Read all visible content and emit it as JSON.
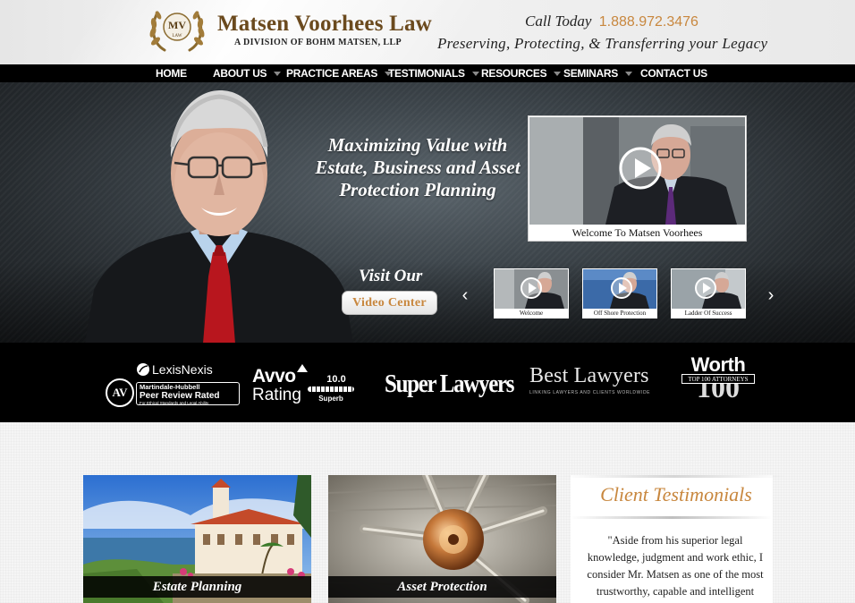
{
  "header": {
    "logo_initials": "MV",
    "logo_seal_word": "LAW",
    "firm_name": "Matsen Voorhees Law",
    "firm_sub": "A DIVISION OF BOHM MATSEN, LLP",
    "call_label": "Call Today",
    "phone": "1.888.972.3476",
    "tagline": "Preserving, Protecting, & Transferring your Legacy"
  },
  "nav": {
    "items": [
      {
        "label": "HOME",
        "has_menu": false
      },
      {
        "label": "ABOUT US",
        "has_menu": true
      },
      {
        "label": "PRACTICE AREAS",
        "has_menu": true
      },
      {
        "label": "TESTIMONIALS",
        "has_menu": true
      },
      {
        "label": "RESOURCES",
        "has_menu": true
      },
      {
        "label": "SEMINARS",
        "has_menu": true
      },
      {
        "label": "CONTACT US",
        "has_menu": false
      }
    ]
  },
  "hero": {
    "headline": "Maximizing Value with Estate, Business and Asset Protection Planning",
    "main_video_caption": "Welcome To Matsen Voorhees",
    "visit_label": "Visit Our",
    "video_center_button": "Video Center",
    "prev_icon": "chevron-left-icon",
    "next_icon": "chevron-right-icon",
    "thumbnails": [
      {
        "caption": "Welcome"
      },
      {
        "caption": "Off Shore Protection"
      },
      {
        "caption": "Ladder Of Success"
      }
    ]
  },
  "badges": {
    "lexis": {
      "brand": "LexisNexis",
      "av": "AV",
      "line1": "Martindale-Hubbell",
      "line2": "Peer Review Rated",
      "line3": "For Ethical Standards and Legal Ability"
    },
    "avvo": {
      "brand": "Avvo",
      "rating_word": "Rating",
      "score": "10.0",
      "score_label": "Superb"
    },
    "super_lawyers": "Super Lawyers",
    "best_lawyers": {
      "name": "Best Lawyers",
      "sub": "LINKING LAWYERS AND CLIENTS WORLDWIDE"
    },
    "worth": {
      "word": "Worth",
      "sub": "TOP 100 ATTORNEYS",
      "number": "100"
    }
  },
  "cards": [
    {
      "label": "Estate Planning"
    },
    {
      "label": "Asset Protection"
    }
  ],
  "testimonials": {
    "title": "Client Testimonials",
    "quote": "\"Aside from his superior legal knowledge, judgment and work ethic, I consider Mr. Matsen as one of the most trustworthy, capable and intelligent"
  },
  "colors": {
    "accent_gold": "#c8873e",
    "logo_brown": "#6b4a1e",
    "nav_bg": "#000000"
  }
}
